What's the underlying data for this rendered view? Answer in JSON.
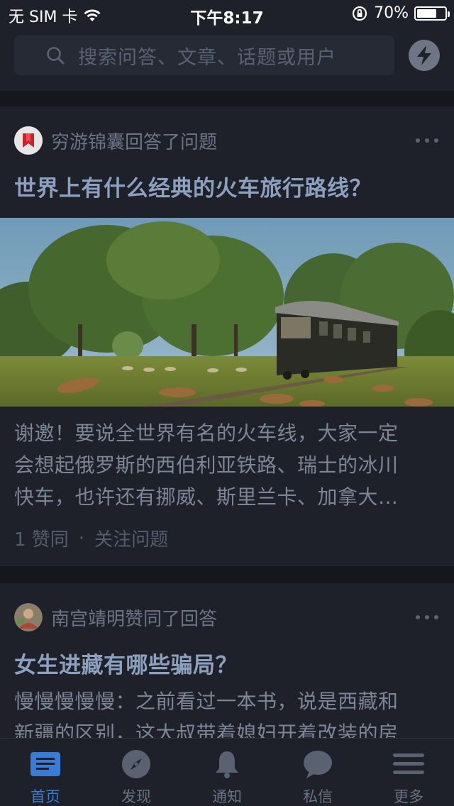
{
  "status_bar": {
    "carrier": "无 SIM 卡",
    "time": "下午8:17",
    "battery_percent": "70%",
    "battery_level": 0.7
  },
  "search": {
    "placeholder": "搜索问答、文章、话题或用户"
  },
  "feed": [
    {
      "actor": "穷游锦囊回答了问题",
      "title": "世界上有什么经典的火车旅行路线？",
      "excerpt_lines": [
        "谢邀！要说全世界有名的火车线，大家一定",
        "会想起俄罗斯的西伯利亚铁路、瑞士的冰川",
        "快车，也许还有挪威、斯里兰卡、加拿大…"
      ],
      "likes": "1 赞同",
      "separator": "·",
      "follow": "关注问题"
    },
    {
      "actor": "南宫靖明赞同了回答",
      "title": "女生进藏有哪些骗局？",
      "excerpt_lines": [
        "慢慢慢慢慢：之前看过一本书，说是西藏和",
        "新疆的区别，这大叔带着媳妇开着改装的房"
      ]
    }
  ],
  "tabs": [
    {
      "label": "首页",
      "icon": "home-icon",
      "active": true
    },
    {
      "label": "发现",
      "icon": "compass-icon",
      "active": false
    },
    {
      "label": "通知",
      "icon": "bell-icon",
      "active": false
    },
    {
      "label": "私信",
      "icon": "chat-icon",
      "active": false
    },
    {
      "label": "更多",
      "icon": "menu-icon",
      "active": false
    }
  ],
  "colors": {
    "background": "#1c1f26",
    "accent": "#3a7bd5",
    "title": "#8da0bd"
  }
}
